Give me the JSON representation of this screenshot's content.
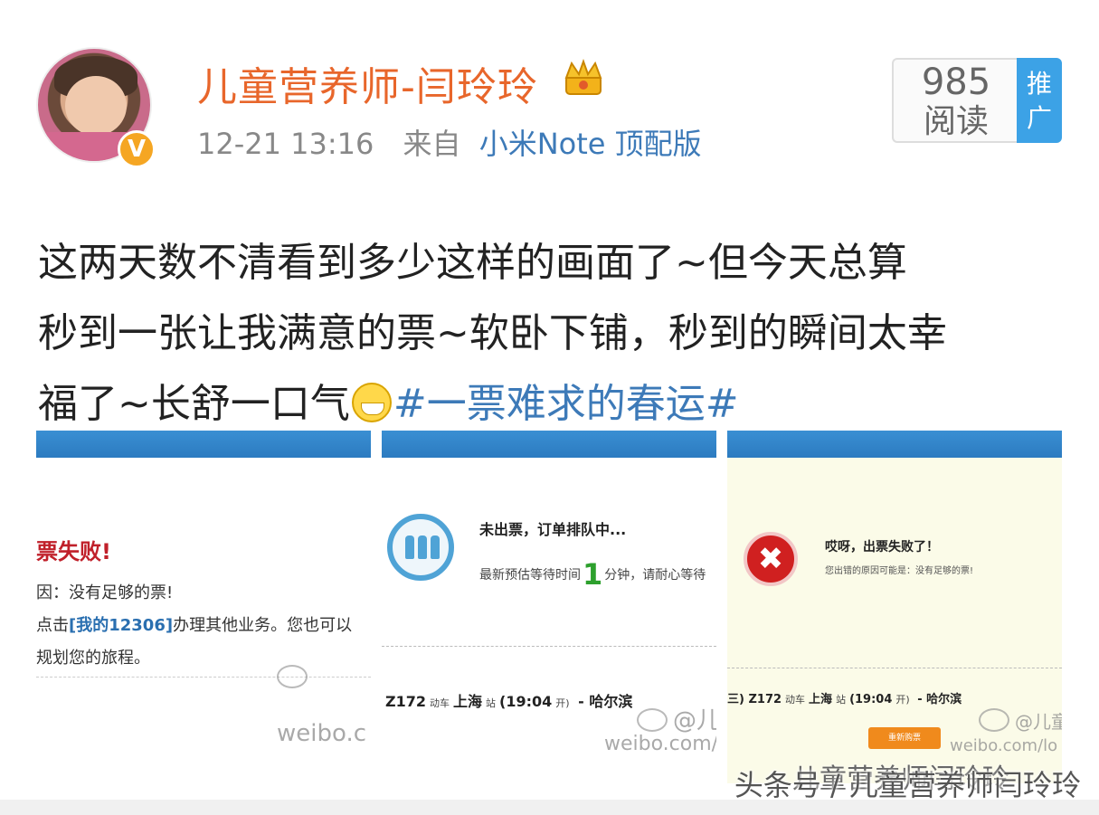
{
  "header": {
    "username": "儿童营养师-闫玲玲",
    "timestamp": "12-21 13:16",
    "source_prefix": "来自",
    "device": "小米Note 顶配版",
    "verified_badge": "V",
    "reads": {
      "count": "985",
      "label": "阅读"
    },
    "promote_label": "推广"
  },
  "post": {
    "line1": "这两天数不清看到多少这样的画面了~但今天总算",
    "line2": "秒到一张让我满意的票~软卧下铺，秒到的瞬间太幸",
    "line3_before": "福了~长舒一口气",
    "emoji": "grin-emoji",
    "hashtag": "#一票难求的春运#"
  },
  "screenshots": {
    "panel1": {
      "title": "票失败!",
      "line1": "因：没有足够的票!",
      "line2_before": "点击",
      "link": "[我的12306]",
      "line2_after": "办理其他业务。您也可以",
      "line3": "规划您的旅程。",
      "watermark": "weibo.c"
    },
    "panel2": {
      "title": "未出票，订单排队中...",
      "sub_before": "最新预估等待时间",
      "wait_minutes": "1",
      "sub_after": "分钟，请耐心等待",
      "train": "Z172",
      "train_type": "动车",
      "from": "上海",
      "station_suffix": "站",
      "time": "(19:04",
      "time_suffix": "开)",
      "to": "哈尔滨",
      "watermark_handle": "@儿",
      "watermark": "weibo.com/l"
    },
    "panel3": {
      "title": "哎呀，出票失败了！",
      "sub": "您出错的原因可能是：没有足够的票!",
      "train_prefix": "三)",
      "train": "Z172",
      "train_type": "动车",
      "from": "上海",
      "station_suffix": "站",
      "time": "(19:04",
      "time_suffix": "开)",
      "to": "哈尔滨",
      "button": "重新购票",
      "watermark_handle": "@儿童",
      "watermark": "weibo.com/lo"
    }
  },
  "footer": {
    "watermark_top": "儿童营养师闫玲玲",
    "watermark": "头条号 / 儿童营养师闫玲玲"
  },
  "colors": {
    "username": "#e8662b",
    "link": "#3d7ab8",
    "promo": "#3ca2e6"
  }
}
